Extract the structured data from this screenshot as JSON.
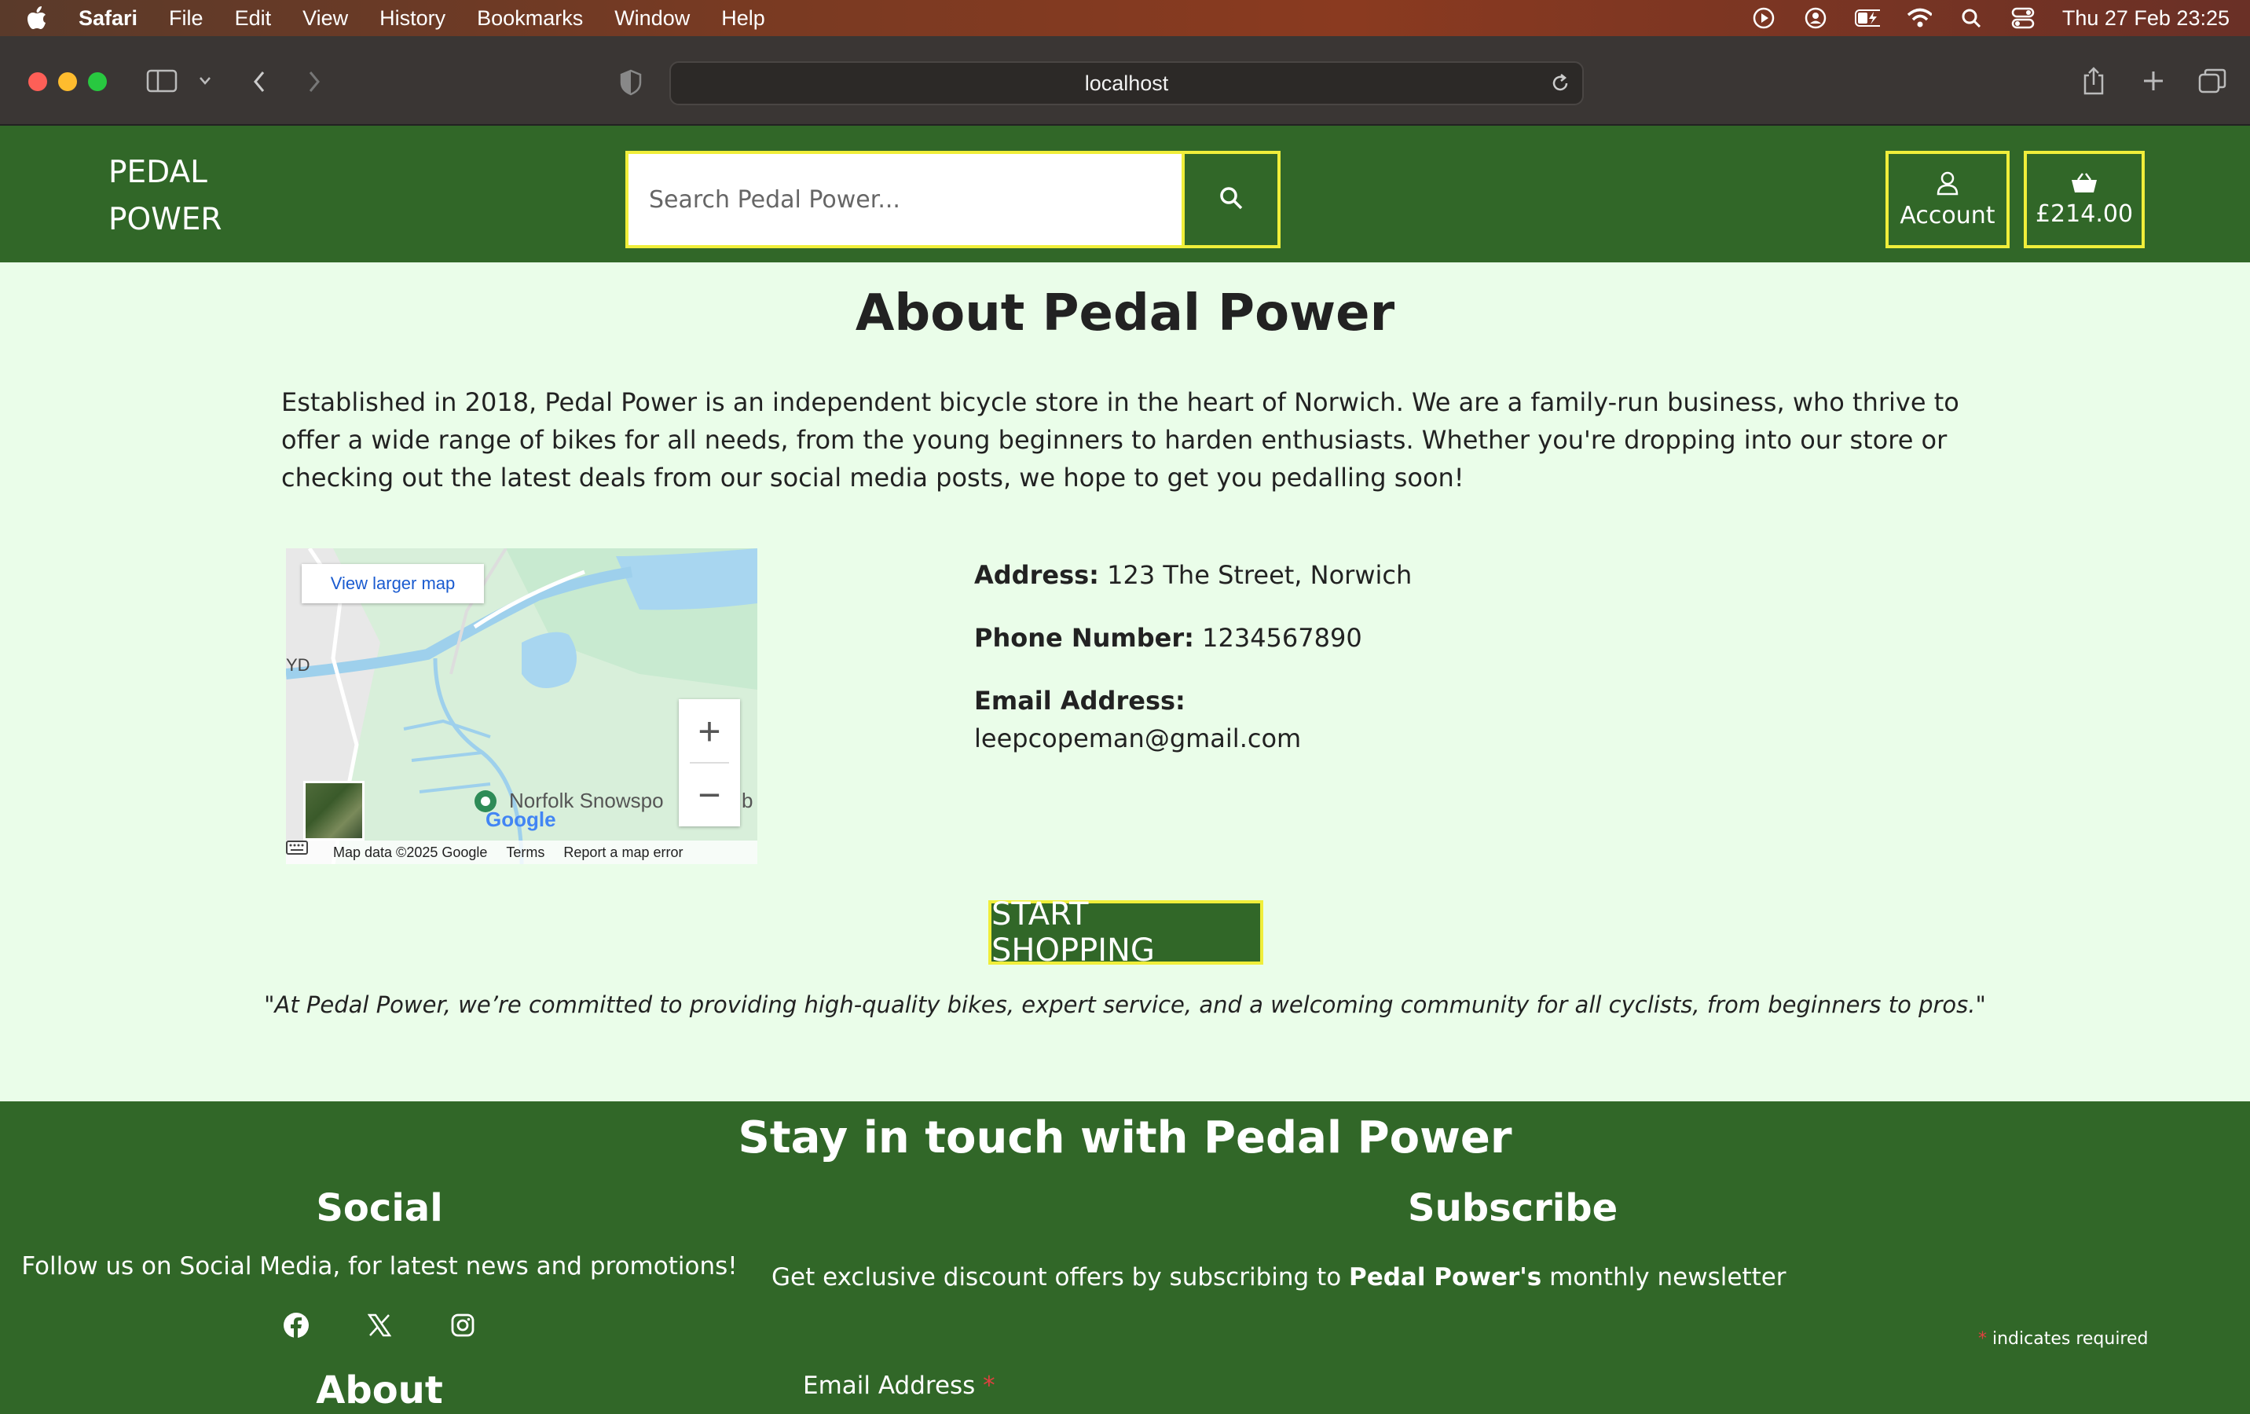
{
  "menubar": {
    "app_name": "Safari",
    "items": [
      "File",
      "Edit",
      "View",
      "History",
      "Bookmarks",
      "Window",
      "Help"
    ],
    "datetime": "Thu 27 Feb  23:25"
  },
  "browser": {
    "url": "localhost"
  },
  "header": {
    "logo_line1": "PEDAL",
    "logo_line2": "POWER",
    "search_placeholder": "Search Pedal Power...",
    "account_label": "Account",
    "cart_total": "£214.00"
  },
  "main": {
    "title": "About Pedal Power",
    "intro": "Established in 2018, Pedal Power is an independent bicycle store in the heart of Norwich. We are a family-run business, who thrive to offer a wide range of bikes for all needs, from the young beginners to harden enthusiasts. Whether you're dropping into our store or checking out the latest deals from our social media posts, we hope to get you pedalling soon!",
    "map": {
      "view_larger": "View larger map",
      "label_yd": "YD",
      "label_place": "Norfolk Snowspo",
      "label_b": "b",
      "google": "Google",
      "map_data": "Map data ©2025 Google",
      "terms": "Terms",
      "report": "Report a map error"
    },
    "contact": {
      "address_label": "Address:",
      "address_value": "123 The Street, Norwich",
      "phone_label": "Phone Number:",
      "phone_value": "1234567890",
      "email_label": "Email Address:",
      "email_value": "leepcopeman@gmail.com"
    },
    "cta_label": "START SHOPPING",
    "quote": "\"At Pedal Power, we’re committed to providing high-quality bikes, expert service, and a welcoming community for all cyclists, from beginners to pros.\""
  },
  "footer": {
    "title": "Stay in touch with Pedal Power",
    "social_heading": "Social",
    "social_text": "Follow us on Social Media, for latest news and promotions!",
    "social_icons": [
      "facebook-icon",
      "x-icon",
      "instagram-icon"
    ],
    "subscribe_heading": "Subscribe",
    "subscribe_text_prefix": "Get exclusive discount offers by subscribing to ",
    "subscribe_text_brand": "Pedal Power's",
    "subscribe_text_suffix": " monthly newsletter",
    "required_star": "*",
    "required_note": " indicates required",
    "about_heading": "About",
    "email_field_label": "Email Address ",
    "email_field_star": "*"
  },
  "colors": {
    "brand_green": "#316728",
    "accent_yellow": "#f0ee3a",
    "page_bg": "#eafde9"
  }
}
